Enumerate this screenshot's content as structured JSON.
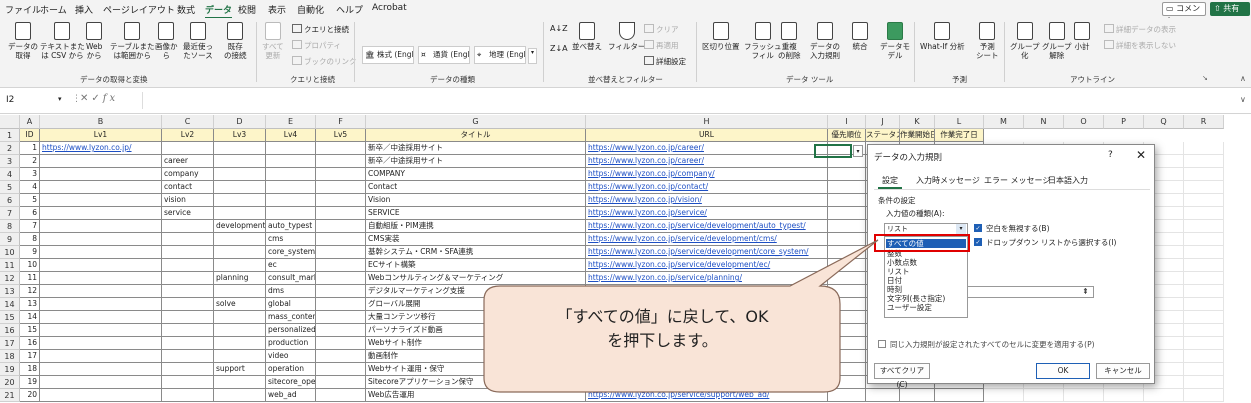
{
  "menu": {
    "items": [
      "ファイル",
      "ホーム",
      "挿入",
      "ページレイアウト",
      "数式",
      "データ",
      "校閲",
      "表示",
      "自動化",
      "ヘルプ",
      "Acrobat"
    ],
    "active": "データ",
    "comment": "コメント",
    "share": "共有"
  },
  "ribbon": {
    "get_data": "データの\n取得",
    "text_csv": "テキストまた\nは CSV から",
    "web": "Web\nから",
    "table_range": "テーブルまた\nは範囲から",
    "image": "画像か\nら",
    "recent": "最近使っ\nたソース",
    "existing": "既存\nの接続",
    "refresh_all": "すべて\n更新",
    "queries": "クエリと接続",
    "properties": "プロパティ",
    "workbook_links": "ブックのリンク",
    "stocks": "株式 (Engli...",
    "currency": "通貨 (Engli...",
    "geography": "地理 (Engli...",
    "sort_asc": "A↓Z",
    "sort_desc": "Z↓A",
    "sort": "並べ替え",
    "filter": "フィルター",
    "clear": "クリア",
    "reapply": "再適用",
    "advanced": "詳細設定",
    "text_to_columns": "区切り位置",
    "flash_fill": "フラッシュ\nフィル",
    "remove_dup": "重複\nの削除",
    "data_validation": "データの\n入力規則",
    "consolidate": "統合",
    "data_model": "データモ\nデル",
    "whatif": "What-If 分析",
    "forecast": "予測\nシート",
    "group": "グループ\n化",
    "ungroup": "グループ\n解除",
    "subtotal": "小計",
    "show_detail": "詳細データの表示",
    "hide_detail": "詳細を表示しない",
    "groups": {
      "get_transform": "データの取得と変換",
      "queries": "クエリと接続",
      "data_types": "データの種類",
      "sort_filter": "並べ替えとフィルター",
      "data_tools": "データ ツール",
      "forecast": "予測",
      "outline": "アウトライン"
    }
  },
  "formula_bar": {
    "name_box": "I2",
    "fx": "fx",
    "value": ""
  },
  "grid": {
    "columns": [
      "A",
      "B",
      "C",
      "D",
      "E",
      "F",
      "G",
      "H",
      "I",
      "J",
      "K",
      "L",
      "M",
      "N",
      "O",
      "P",
      "Q",
      "R"
    ],
    "header_row": [
      "ID",
      "Lv1",
      "Lv2",
      "Lv3",
      "Lv4",
      "Lv5",
      "タイトル",
      "URL",
      "優先順位",
      "ステータス",
      "作業開始日",
      "作業完了日"
    ],
    "rows": [
      [
        "1",
        "https://www.lyzon.co.jp/",
        "",
        "",
        "",
        "",
        "新卒／中途採用サイト",
        "https://www.lyzon.co.jp/career/"
      ],
      [
        "2",
        "",
        "career",
        "",
        "",
        "",
        "新卒／中途採用サイト",
        "https://www.lyzon.co.jp/career/"
      ],
      [
        "3",
        "",
        "company",
        "",
        "",
        "",
        "COMPANY",
        "https://www.lyzon.co.jp/company/"
      ],
      [
        "4",
        "",
        "contact",
        "",
        "",
        "",
        "Contact",
        "https://www.lyzon.co.jp/contact/"
      ],
      [
        "5",
        "",
        "vision",
        "",
        "",
        "",
        "Vision",
        "https://www.lyzon.co.jp/vision/"
      ],
      [
        "6",
        "",
        "service",
        "",
        "",
        "",
        "SERVICE",
        "https://www.lyzon.co.jp/service/"
      ],
      [
        "7",
        "",
        "",
        "development",
        "auto_typest",
        "",
        "自動組版・PIM連携",
        "https://www.lyzon.co.jp/service/development/auto_typest/"
      ],
      [
        "8",
        "",
        "",
        "",
        "cms",
        "",
        "CMS実装",
        "https://www.lyzon.co.jp/service/development/cms/"
      ],
      [
        "9",
        "",
        "",
        "",
        "core_system",
        "",
        "基幹システム・CRM・SFA連携",
        "https://www.lyzon.co.jp/service/development/core_system/"
      ],
      [
        "10",
        "",
        "",
        "",
        "ec",
        "",
        "ECサイト構築",
        "https://www.lyzon.co.jp/service/development/ec/"
      ],
      [
        "11",
        "",
        "",
        "planning",
        "consult_market",
        "",
        "Webコンサルティング＆マーケティング",
        "https://www.lyzon.co.jp/service/planning/"
      ],
      [
        "12",
        "",
        "",
        "",
        "dms",
        "",
        "デジタルマーケティング支援",
        ""
      ],
      [
        "13",
        "",
        "",
        "solve",
        "global",
        "",
        "グローバル展開",
        ""
      ],
      [
        "14",
        "",
        "",
        "",
        "mass_content",
        "",
        "大量コンテンツ移行",
        ""
      ],
      [
        "15",
        "",
        "",
        "",
        "personalizedmovie",
        "",
        "パーソナライズド動画",
        ""
      ],
      [
        "16",
        "",
        "",
        "",
        "production",
        "",
        "Webサイト制作",
        ""
      ],
      [
        "17",
        "",
        "",
        "",
        "video",
        "",
        "動画制作",
        ""
      ],
      [
        "18",
        "",
        "",
        "support",
        "operation",
        "",
        "Webサイト運用・保守",
        ""
      ],
      [
        "19",
        "",
        "",
        "",
        "sitecore_operation",
        "",
        "Sitecoreアプリケーション保守",
        ""
      ],
      [
        "20",
        "",
        "",
        "",
        "web_ad",
        "",
        "Web広告運用",
        "https://www.lyzon.co.jp/service/support/web_ad/"
      ]
    ],
    "row_numbers": [
      "1",
      "2",
      "3",
      "4",
      "5",
      "6",
      "7",
      "8",
      "9",
      "10",
      "11",
      "12",
      "13",
      "14",
      "15",
      "16",
      "17",
      "18",
      "19",
      "20",
      "21"
    ]
  },
  "dialog": {
    "title": "データの入力規則",
    "help": "?",
    "close": "✕",
    "tabs": [
      "設定",
      "入力時メッセージ",
      "エラー メッセージ",
      "日本語入力"
    ],
    "conditions_label": "条件の設定",
    "type_label": "入力値の種類(A):",
    "selected_type": "リスト",
    "ignore_blank": "空白を無視する(B)",
    "in_cell_dropdown": "ドロップダウン リストから選択する(I)",
    "options": [
      "すべての値",
      "整数",
      "小数点数",
      "リスト",
      "日付",
      "時刻",
      "文字列(長さ指定)",
      "ユーザー設定"
    ],
    "apply_all": "同じ入力規則が設定されたすべてのセルに変更を適用する(P)",
    "clear_all": "すべてクリア(C)",
    "ok": "OK",
    "cancel": "キャンセル"
  },
  "callout": {
    "line1": "「すべての値」に戻して、OK",
    "line2": "を押下します。"
  },
  "colors": {
    "accent": "#217346",
    "header_fill": "#fdf5c9",
    "highlight": "#e00000",
    "callout_fill": "#f9e4d7",
    "callout_border": "#8a6a5a",
    "selection": "#1e5fb5"
  }
}
